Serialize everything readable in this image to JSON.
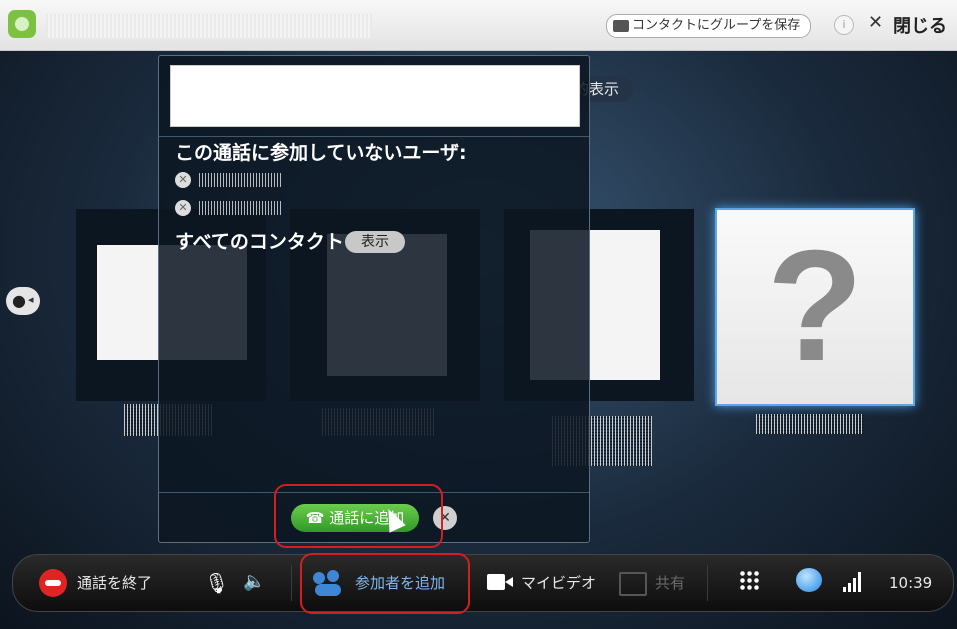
{
  "topbar": {
    "save_group_label": "コンタクトにグループを保存",
    "info_label": "i",
    "close_label": "閉じる"
  },
  "view_pill_label": "的表示",
  "panel": {
    "not_in_call_heading": "この通話に参加していないユーザ:",
    "all_contacts_label": "すべてのコンタクト",
    "show_label": "表示",
    "add_to_call_label": "通話に追加"
  },
  "callbar": {
    "end_call_label": "通話を終了",
    "add_participants_label": "参加者を追加",
    "my_video_label": "マイビデオ",
    "share_label": "共有",
    "time": "10:39"
  },
  "colors": {
    "accent_blue": "#5ea6e6",
    "end_call_red": "#e02424",
    "add_green": "#2f9a25",
    "highlight_red": "#d21f1f"
  },
  "icons": [
    "skype-logo-icon",
    "group-icon",
    "info-icon",
    "close-icon",
    "user-icon",
    "skype-offline-icon",
    "phone-icon",
    "clear-icon",
    "microphone-muted-icon",
    "speaker-icon",
    "participants-icon",
    "video-camera-icon",
    "share-screen-icon",
    "dialpad-icon",
    "chat-icon",
    "signal-icon"
  ]
}
